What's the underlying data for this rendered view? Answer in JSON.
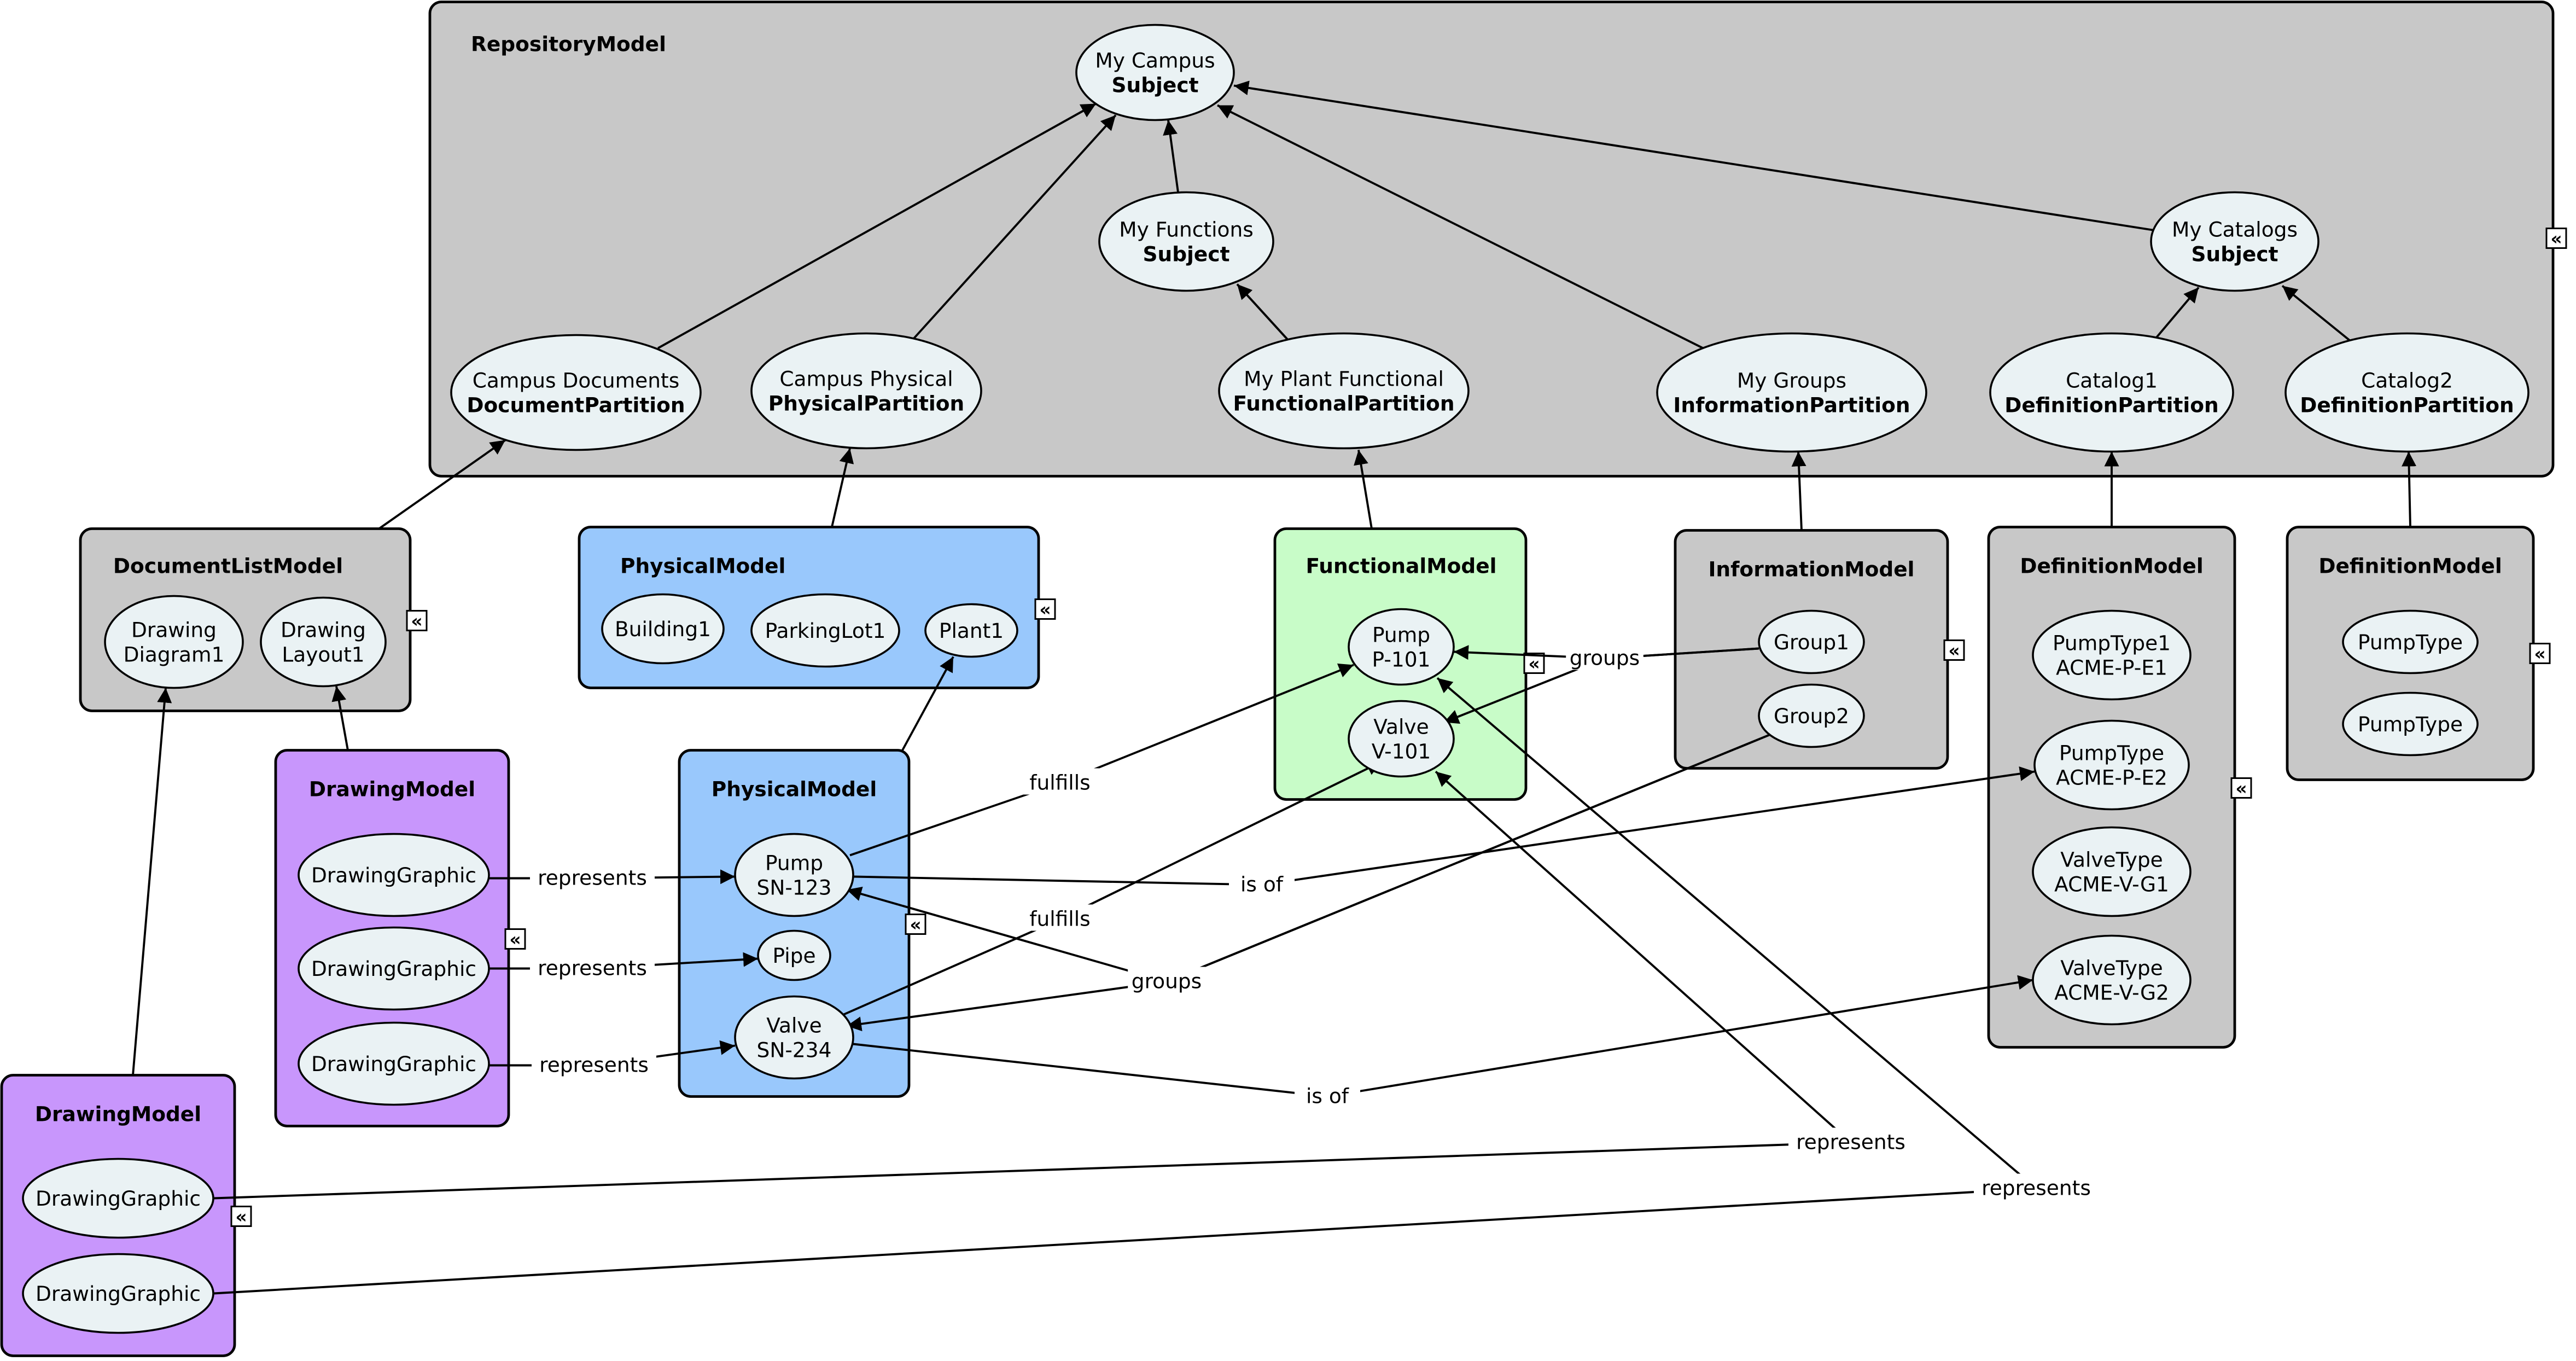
{
  "colors": {
    "repository": "#c8c8c8",
    "document_list": "#c8c8c8",
    "physical": "#99c8fc",
    "functional": "#c8fcc8",
    "information": "#c8c8c8",
    "definition": "#c8c8c8",
    "drawing": "#c896fc",
    "node_fill": "#eaf2f4"
  },
  "toggle_icon": "collapse-icon",
  "toggle_glyph": "«",
  "containers": [
    {
      "id": "repo",
      "title": "RepositoryModel",
      "color_key": "repository"
    },
    {
      "id": "doclist",
      "title": "DocumentListModel",
      "color_key": "document_list"
    },
    {
      "id": "phys1",
      "title": "PhysicalModel",
      "color_key": "physical"
    },
    {
      "id": "func",
      "title": "FunctionalModel",
      "color_key": "functional"
    },
    {
      "id": "info",
      "title": "InformationModel",
      "color_key": "information"
    },
    {
      "id": "def1",
      "title": "DefinitionModel",
      "color_key": "definition"
    },
    {
      "id": "def2",
      "title": "DefinitionModel",
      "color_key": "definition"
    },
    {
      "id": "draw1",
      "title": "DrawingModel",
      "color_key": "drawing"
    },
    {
      "id": "phys2",
      "title": "PhysicalModel",
      "color_key": "physical"
    },
    {
      "id": "draw2",
      "title": "DrawingModel",
      "color_key": "drawing"
    }
  ],
  "nodes": [
    {
      "id": "campus",
      "lines": [
        "My Campus",
        "Subject"
      ],
      "bold_last": true
    },
    {
      "id": "functions",
      "lines": [
        "My Functions",
        "Subject"
      ],
      "bold_last": true
    },
    {
      "id": "catalogs",
      "lines": [
        "My Catalogs",
        "Subject"
      ],
      "bold_last": true
    },
    {
      "id": "docpart",
      "lines": [
        "Campus Documents",
        "DocumentPartition"
      ],
      "bold_last": true
    },
    {
      "id": "physpart",
      "lines": [
        "Campus Physical",
        "PhysicalPartition"
      ],
      "bold_last": true
    },
    {
      "id": "funcpart",
      "lines": [
        "My Plant Functional",
        "FunctionalPartition"
      ],
      "bold_last": true
    },
    {
      "id": "infopart",
      "lines": [
        "My Groups",
        "InformationPartition"
      ],
      "bold_last": true
    },
    {
      "id": "cat1",
      "lines": [
        "Catalog1",
        "DefinitionPartition"
      ],
      "bold_last": true
    },
    {
      "id": "cat2",
      "lines": [
        "Catalog2",
        "DefinitionPartition"
      ],
      "bold_last": true
    },
    {
      "id": "diagram1",
      "lines": [
        "Drawing",
        "Diagram1"
      ],
      "bold_last": false
    },
    {
      "id": "layout1",
      "lines": [
        "Drawing",
        "Layout1"
      ],
      "bold_last": false
    },
    {
      "id": "building1",
      "lines": [
        "Building1"
      ],
      "bold_last": false
    },
    {
      "id": "parkinglot1",
      "lines": [
        "ParkingLot1"
      ],
      "bold_last": false
    },
    {
      "id": "plant1",
      "lines": [
        "Plant1"
      ],
      "bold_last": false
    },
    {
      "id": "p101",
      "lines": [
        "Pump",
        "P-101"
      ],
      "bold_last": false
    },
    {
      "id": "v101",
      "lines": [
        "Valve",
        "V-101"
      ],
      "bold_last": false
    },
    {
      "id": "group1",
      "lines": [
        "Group1"
      ],
      "bold_last": false
    },
    {
      "id": "group2",
      "lines": [
        "Group2"
      ],
      "bold_last": false
    },
    {
      "id": "pt1",
      "lines": [
        "PumpType1",
        "ACME-P-E1"
      ],
      "bold_last": false
    },
    {
      "id": "pt2",
      "lines": [
        "PumpType",
        "ACME-P-E2"
      ],
      "bold_last": false
    },
    {
      "id": "vt1",
      "lines": [
        "ValveType",
        "ACME-V-G1"
      ],
      "bold_last": false
    },
    {
      "id": "vt2",
      "lines": [
        "ValveType",
        "ACME-V-G2"
      ],
      "bold_last": false
    },
    {
      "id": "ptA",
      "lines": [
        "PumpType"
      ],
      "bold_last": false
    },
    {
      "id": "ptB",
      "lines": [
        "PumpType"
      ],
      "bold_last": false
    },
    {
      "id": "dg1",
      "lines": [
        "DrawingGraphic"
      ],
      "bold_last": false
    },
    {
      "id": "dg2",
      "lines": [
        "DrawingGraphic"
      ],
      "bold_last": false
    },
    {
      "id": "dg3",
      "lines": [
        "DrawingGraphic"
      ],
      "bold_last": false
    },
    {
      "id": "sn123",
      "lines": [
        "Pump",
        "SN-123"
      ],
      "bold_last": false
    },
    {
      "id": "pipe",
      "lines": [
        "Pipe"
      ],
      "bold_last": false
    },
    {
      "id": "sn234",
      "lines": [
        "Valve",
        "SN-234"
      ],
      "bold_last": false
    },
    {
      "id": "dg4",
      "lines": [
        "DrawingGraphic"
      ],
      "bold_last": false
    },
    {
      "id": "dg5",
      "lines": [
        "DrawingGraphic"
      ],
      "bold_last": false
    }
  ],
  "edge_labels": {
    "represents": "represents",
    "fulfills": "fulfills",
    "is_of": "is of",
    "groups": "groups"
  },
  "edges": [
    {
      "from": "functions",
      "to": "campus",
      "label": ""
    },
    {
      "from": "catalogs",
      "to": "campus",
      "label": ""
    },
    {
      "from": "docpart",
      "to": "campus",
      "label": ""
    },
    {
      "from": "physpart",
      "to": "campus",
      "label": ""
    },
    {
      "from": "infopart",
      "to": "campus",
      "label": ""
    },
    {
      "from": "funcpart",
      "to": "functions",
      "label": ""
    },
    {
      "from": "cat1",
      "to": "catalogs",
      "label": ""
    },
    {
      "from": "cat2",
      "to": "catalogs",
      "label": ""
    },
    {
      "from": "doclist",
      "to": "docpart",
      "label": ""
    },
    {
      "from": "phys1",
      "to": "physpart",
      "label": ""
    },
    {
      "from": "func",
      "to": "funcpart",
      "label": ""
    },
    {
      "from": "info",
      "to": "infopart",
      "label": ""
    },
    {
      "from": "def1",
      "to": "cat1",
      "label": ""
    },
    {
      "from": "def2",
      "to": "cat2",
      "label": ""
    },
    {
      "from": "draw2",
      "to": "diagram1",
      "label": ""
    },
    {
      "from": "draw1",
      "to": "layout1",
      "label": ""
    },
    {
      "from": "phys2",
      "to": "plant1",
      "label": ""
    },
    {
      "from": "dg1",
      "to": "sn123",
      "label": "represents"
    },
    {
      "from": "dg2",
      "to": "pipe",
      "label": "represents"
    },
    {
      "from": "dg3",
      "to": "sn234",
      "label": "represents"
    },
    {
      "from": "sn123",
      "to": "p101",
      "label": "fulfills"
    },
    {
      "from": "sn234",
      "to": "v101",
      "label": "fulfills"
    },
    {
      "from": "sn123",
      "to": "pt2",
      "label": "is of"
    },
    {
      "from": "sn234",
      "to": "vt2",
      "label": "is of"
    },
    {
      "from": "group1",
      "to": "p101",
      "label": "groups"
    },
    {
      "from": "group1",
      "to": "v101",
      "label": "groups"
    },
    {
      "from": "group2",
      "to": "sn123",
      "label": "groups"
    },
    {
      "from": "group2",
      "to": "sn234",
      "label": "groups"
    },
    {
      "from": "dg4",
      "to": "v101",
      "label": "represents"
    },
    {
      "from": "dg5",
      "to": "p101",
      "label": "represents"
    }
  ]
}
